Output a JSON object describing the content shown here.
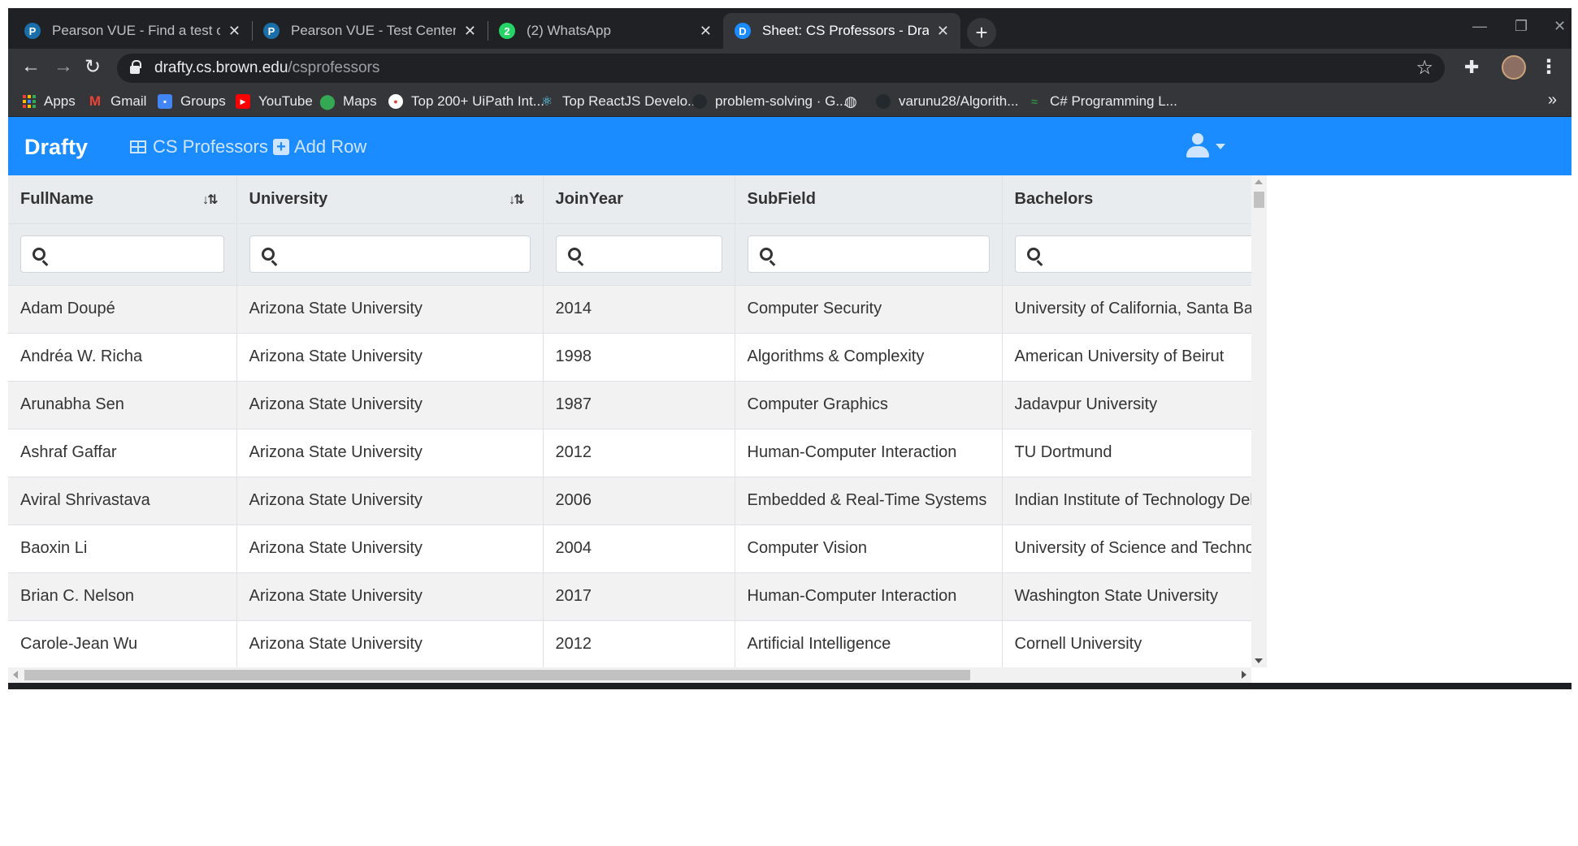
{
  "browser": {
    "tabs": [
      {
        "title": "Pearson VUE - Find a test center",
        "favicon": "P",
        "favicon_color": "#1a6fa8",
        "active": false
      },
      {
        "title": "Pearson VUE - Test Center Inform",
        "favicon": "P",
        "favicon_color": "#1a6fa8",
        "active": false
      },
      {
        "title": "(2) WhatsApp",
        "favicon": "2",
        "favicon_color": "#25d366",
        "active": false
      },
      {
        "title": "Sheet: CS Professors - Drafty",
        "favicon": "D",
        "favicon_color": "#1a8cff",
        "active": true
      }
    ],
    "new_tab": "+",
    "url_host": "drafty.cs.brown.edu",
    "url_path": "/csprofessors",
    "bookmarks": [
      {
        "label": "Apps",
        "icon": "apps-grid-icon"
      },
      {
        "label": "Gmail",
        "icon": "gmail-icon"
      },
      {
        "label": "Groups",
        "icon": "groups-icon"
      },
      {
        "label": "YouTube",
        "icon": "youtube-icon"
      },
      {
        "label": "Maps",
        "icon": "maps-icon"
      },
      {
        "label": "Top 200+ UiPath Int...",
        "icon": "uipath-icon"
      },
      {
        "label": "Top ReactJS Develo...",
        "icon": "react-icon"
      },
      {
        "label": "problem-solving · G...",
        "icon": "github-icon"
      },
      {
        "label": "",
        "icon": "globe-icon"
      },
      {
        "label": "varunu28/Algorith...",
        "icon": "github-icon"
      },
      {
        "label": "C# Programming L...",
        "icon": "geeks-icon"
      }
    ],
    "bookmarks_more": "»"
  },
  "app": {
    "brand": "Drafty",
    "sheet_menu": "CS Professors",
    "add_row": "Add Row",
    "accent": "#1a8cff"
  },
  "table": {
    "columns": [
      "FullName",
      "University",
      "JoinYear",
      "SubField",
      "Bachelors"
    ],
    "sortable": [
      true,
      true,
      false,
      false,
      false
    ],
    "rows": [
      [
        "Adam Doupé",
        "Arizona State University",
        "2014",
        "Computer Security",
        "University of California, Santa Barbara"
      ],
      [
        "Andréa W. Richa",
        "Arizona State University",
        "1998",
        "Algorithms & Complexity",
        "American University of Beirut"
      ],
      [
        "Arunabha Sen",
        "Arizona State University",
        "1987",
        "Computer Graphics",
        "Jadavpur University"
      ],
      [
        "Ashraf Gaffar",
        "Arizona State University",
        "2012",
        "Human-Computer Interaction",
        "TU Dortmund"
      ],
      [
        "Aviral Shrivastava",
        "Arizona State University",
        "2006",
        "Embedded & Real-Time Systems",
        "Indian Institute of Technology Delhi"
      ],
      [
        "Baoxin Li",
        "Arizona State University",
        "2004",
        "Computer Vision",
        "University of Science and Technology"
      ],
      [
        "Brian C. Nelson",
        "Arizona State University",
        "2017",
        "Human-Computer Interaction",
        "Washington State University"
      ],
      [
        "Carole-Jean Wu",
        "Arizona State University",
        "2012",
        "Artificial Intelligence",
        "Cornell University"
      ]
    ]
  }
}
